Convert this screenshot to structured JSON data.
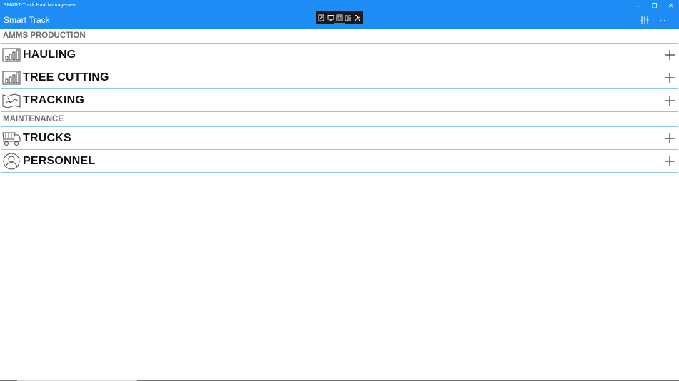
{
  "window": {
    "title": "SMART-Track Haul Management",
    "controls": {
      "minimize": "–",
      "restore": "❐",
      "close": "✕"
    }
  },
  "app": {
    "title": "Smart Track"
  },
  "colors": {
    "accent": "#1e8cf5",
    "divider": "#8ec6e6",
    "section_text": "#6d6d6d"
  },
  "floating_toolbar": {
    "icons": [
      "capture-icon",
      "screen-icon",
      "window-icon",
      "region-icon",
      "freeform-icon"
    ]
  },
  "app_actions": {
    "settings_icon": "sliders-icon",
    "more": "···"
  },
  "sections": [
    {
      "title": "AMMS PRODUCTION",
      "items": [
        {
          "label": "HAULING",
          "icon": "bar-chart-icon"
        },
        {
          "label": "TREE CUTTING",
          "icon": "bar-chart-icon"
        },
        {
          "label": "TRACKING",
          "icon": "map-icon"
        }
      ]
    },
    {
      "title": "MAINTENANCE",
      "items": [
        {
          "label": "TRUCKS",
          "icon": "truck-icon"
        },
        {
          "label": "PERSONNEL",
          "icon": "person-icon"
        }
      ]
    }
  ]
}
